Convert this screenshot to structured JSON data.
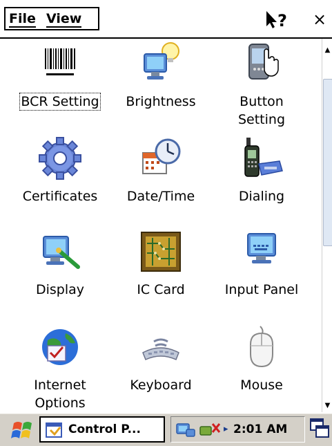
{
  "menubar": {
    "file_label": "File",
    "view_label": "View",
    "help_label": "?",
    "close_label": "×"
  },
  "items": [
    {
      "label": "BCR Setting",
      "icon": "barcode-icon"
    },
    {
      "label": "Brightness",
      "icon": "brightness-icon"
    },
    {
      "label": "Button\nSetting",
      "icon": "button-setting-icon"
    },
    {
      "label": "Certificates",
      "icon": "certificates-gear-icon"
    },
    {
      "label": "Date/Time",
      "icon": "date-time-icon"
    },
    {
      "label": "Dialing",
      "icon": "dialing-phone-icon"
    },
    {
      "label": "Display",
      "icon": "display-icon"
    },
    {
      "label": "IC Card",
      "icon": "ic-card-chip-icon"
    },
    {
      "label": "Input Panel",
      "icon": "input-panel-keyboard-icon"
    },
    {
      "label": "Internet\nOptions",
      "icon": "internet-options-globe-icon"
    },
    {
      "label": "Keyboard",
      "icon": "keyboard-icon"
    },
    {
      "label": "Mouse",
      "icon": "mouse-icon"
    }
  ],
  "taskbar": {
    "task_label": "Control P...",
    "clock": "2:01 AM",
    "tray_arrow": "▸"
  },
  "colors": {
    "taskbar_bg": "#d4d0c8",
    "scroll_thumb": "#dfe8f4"
  }
}
